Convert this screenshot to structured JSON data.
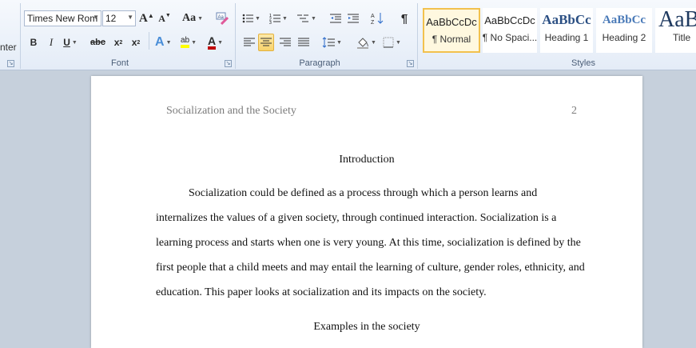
{
  "ribbon": {
    "clipboard_fragment": "nter",
    "font": {
      "label": "Font",
      "name_value": "Times New Rom",
      "size_value": "12",
      "grow_icon": "A",
      "shrink_icon": "A",
      "case_label": "Aa",
      "bold": "B",
      "italic": "I",
      "underline": "U",
      "strike": "abc",
      "subscript": "x",
      "superscript": "x",
      "effects": "A",
      "highlight": "ab",
      "color_a": "A",
      "color_accent": "#c00000"
    },
    "paragraph": {
      "label": "Paragraph",
      "pilcrow": "¶"
    },
    "styles": {
      "label": "Styles",
      "items": [
        {
          "preview": "AaBbCcDc",
          "name": "¶ Normal",
          "selected": true
        },
        {
          "preview": "AaBbCcDc",
          "name": "¶ No Spaci..."
        },
        {
          "preview": "AaBbCc",
          "name": "Heading 1"
        },
        {
          "preview": "AaBbCc",
          "name": "Heading 2"
        },
        {
          "preview": "AaB",
          "name": "Title"
        }
      ]
    }
  },
  "document": {
    "header_title": "Socialization and the Society",
    "page_number": "2",
    "heading_intro": "Introduction",
    "lines": [
      "Socialization could be defined as a process through which a person learns and",
      "internalizes the values of a given society, through continued interaction. Socialization is a",
      "learning process and starts when one is very young. At this time, socialization is defined by the",
      "first people that a child meets and may entail the learning of culture, gender roles, ethnicity, and",
      "education. This paper looks at socialization and its impacts on the society."
    ],
    "heading_examples": "Examples in the society"
  }
}
